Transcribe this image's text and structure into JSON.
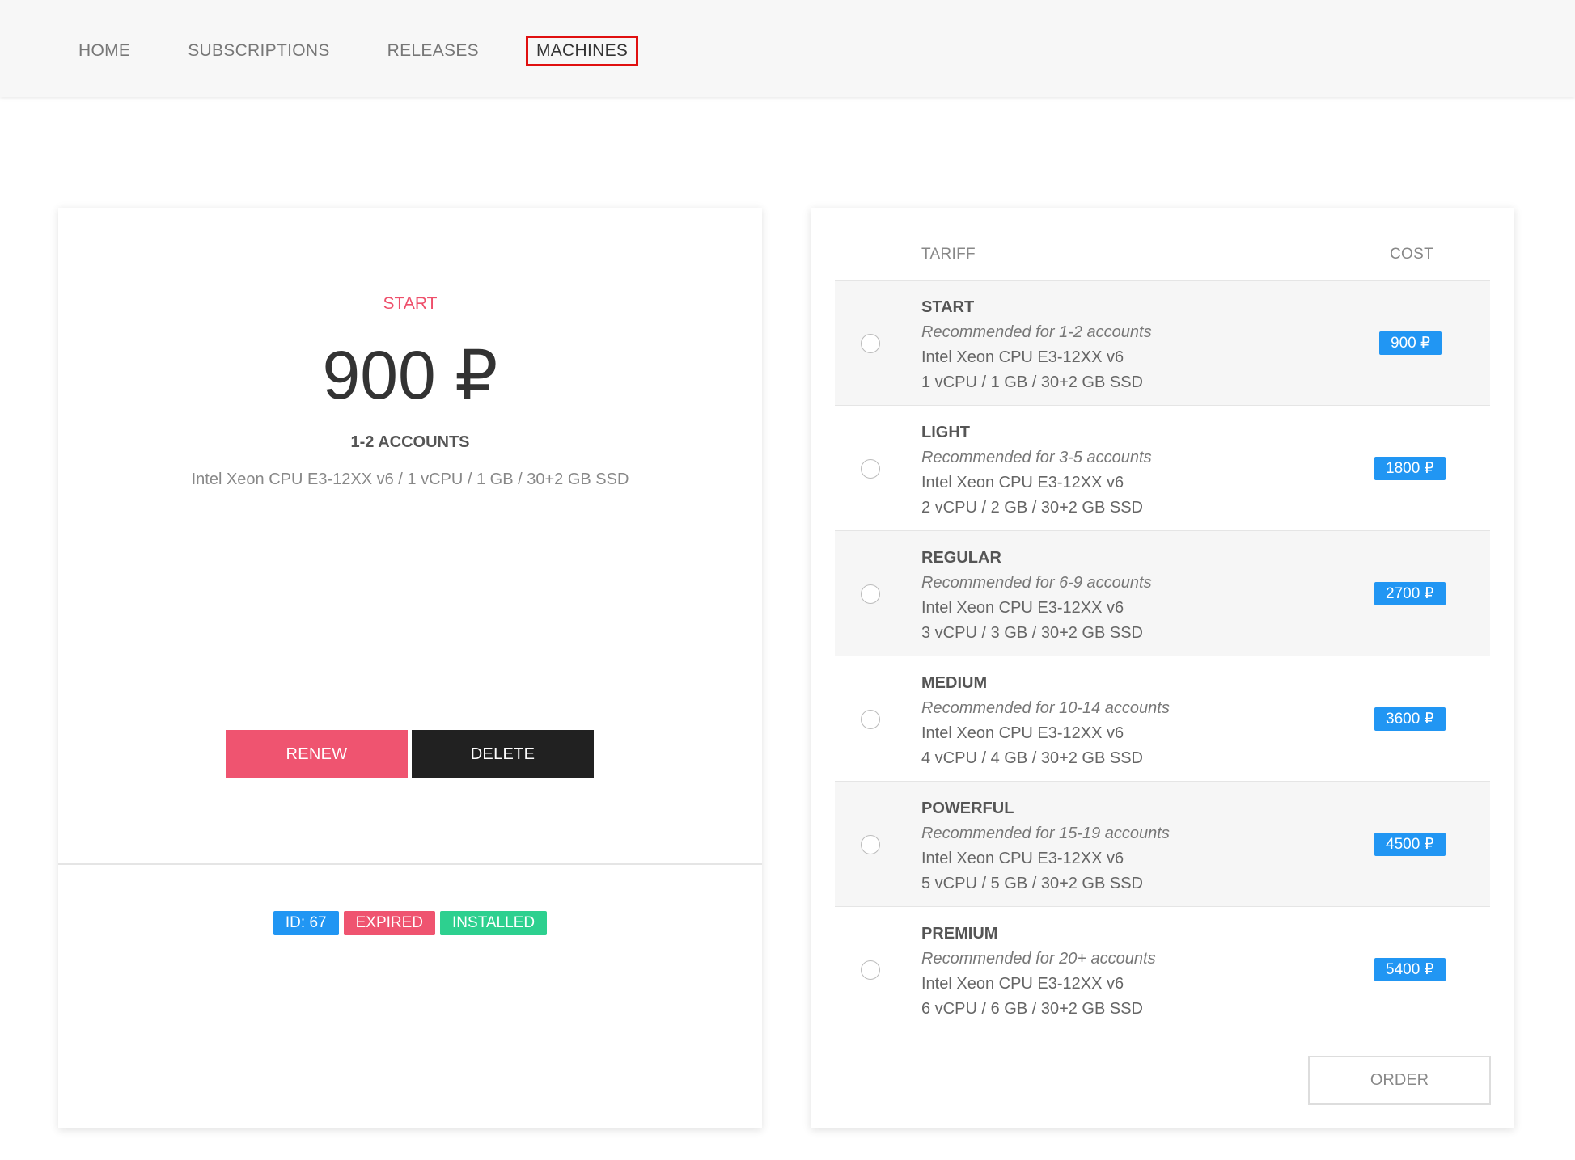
{
  "nav": {
    "items": [
      {
        "label": "HOME",
        "active": false
      },
      {
        "label": "SUBSCRIPTIONS",
        "active": false
      },
      {
        "label": "RELEASES",
        "active": false
      },
      {
        "label": "MACHINES",
        "active": true
      }
    ]
  },
  "machine": {
    "plan": "START",
    "price": "900 ₽",
    "accounts": "1-2 ACCOUNTS",
    "specs": "Intel Xeon CPU E3-12XX v6 / 1 vCPU / 1 GB / 30+2 GB SSD",
    "renew_label": "RENEW",
    "delete_label": "DELETE",
    "badges": {
      "id": "ID: 67",
      "status": "EXPIRED",
      "install": "INSTALLED"
    }
  },
  "tariffs": {
    "header_tariff": "TARIFF",
    "header_cost": "COST",
    "rows": [
      {
        "name": "START",
        "recommended": "Recommended for 1-2 accounts",
        "cpu": "Intel Xeon CPU E3-12XX v6",
        "spec": "1 vCPU / 1 GB / 30+2 GB SSD",
        "price": "900 ₽"
      },
      {
        "name": "LIGHT",
        "recommended": "Recommended for 3-5 accounts",
        "cpu": "Intel Xeon CPU E3-12XX v6",
        "spec": "2 vCPU / 2 GB / 30+2 GB SSD",
        "price": "1800 ₽"
      },
      {
        "name": "REGULAR",
        "recommended": "Recommended for 6-9 accounts",
        "cpu": "Intel Xeon CPU E3-12XX v6",
        "spec": "3 vCPU / 3 GB / 30+2 GB SSD",
        "price": "2700 ₽"
      },
      {
        "name": "MEDIUM",
        "recommended": "Recommended for 10-14 accounts",
        "cpu": "Intel Xeon CPU E3-12XX v6",
        "spec": "4 vCPU / 4 GB / 30+2 GB SSD",
        "price": "3600 ₽"
      },
      {
        "name": "POWERFUL",
        "recommended": "Recommended for 15-19 accounts",
        "cpu": "Intel Xeon CPU E3-12XX v6",
        "spec": "5 vCPU / 5 GB / 30+2 GB SSD",
        "price": "4500 ₽"
      },
      {
        "name": "PREMIUM",
        "recommended": "Recommended for 20+ accounts",
        "cpu": "Intel Xeon CPU E3-12XX v6",
        "spec": "6 vCPU / 6 GB / 30+2 GB SSD",
        "price": "5400 ₽"
      }
    ],
    "order_label": "ORDER"
  }
}
